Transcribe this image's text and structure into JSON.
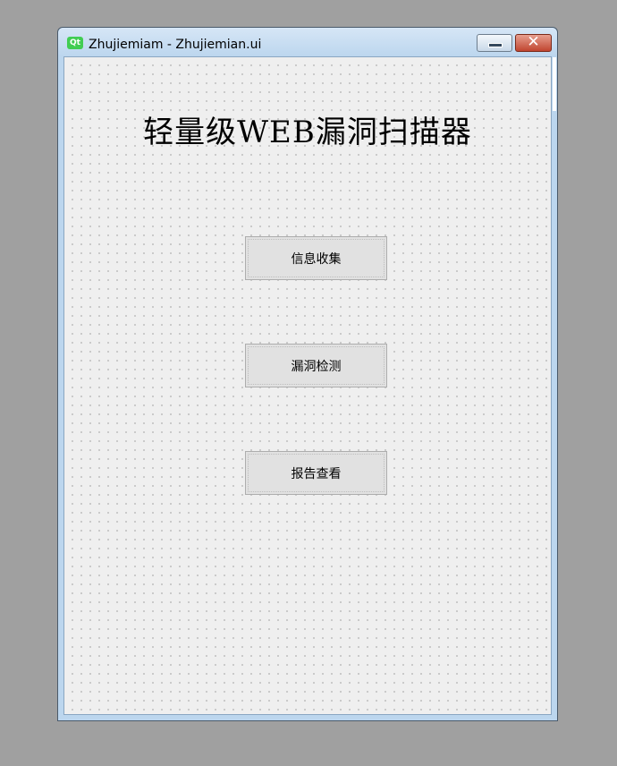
{
  "window": {
    "title": "Zhujiemiam - Zhujiemian.ui",
    "logo_text": "Qt",
    "close_glyph": "✕"
  },
  "main": {
    "heading": "轻量级WEB漏洞扫描器",
    "buttons": [
      {
        "label": "信息收集"
      },
      {
        "label": "漏洞检测"
      },
      {
        "label": "报告查看"
      }
    ]
  },
  "icons": {
    "app": "qt-logo-icon",
    "minimize": "minimize-icon",
    "close": "close-icon"
  },
  "colors": {
    "desktop": "#a0a0a0",
    "titlebar": "#bcd6ee",
    "client": "#efefef",
    "button": "#e1e1e1",
    "close_button": "#c04530",
    "qt_green": "#41cd52"
  }
}
